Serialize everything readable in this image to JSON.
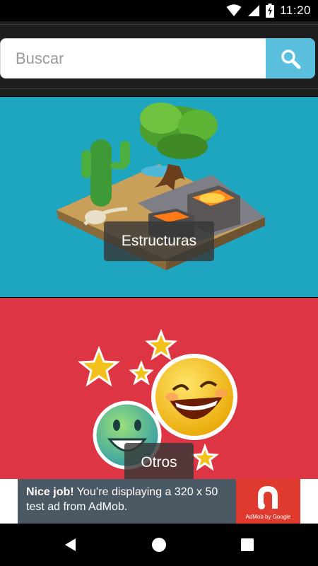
{
  "status_bar": {
    "time": "11:20",
    "icons": [
      "wifi-icon",
      "signal-icon",
      "battery-charging-icon"
    ]
  },
  "search": {
    "placeholder": "Buscar",
    "value": "",
    "button_icon": "search-icon"
  },
  "categories": [
    {
      "label": "Estructuras",
      "background": "#1ea5c0",
      "icon": "desert-island-structures-illustration"
    },
    {
      "label": "Otros",
      "background": "#de3545",
      "icon": "smiley-faces-stars-illustration"
    }
  ],
  "ad": {
    "headline": "Nice job!",
    "body": " You’re displaying a 320 x 50 test ad from AdMob.",
    "logo_caption": "AdMob by Google"
  },
  "nav_bar": {
    "buttons": [
      "back-icon",
      "home-icon",
      "recents-icon"
    ]
  },
  "colors": {
    "search_button": "#5bc0de",
    "app_bar": "#1e1e1e",
    "ad_background": "#4a5964",
    "ad_logo": "#e03a2f"
  }
}
